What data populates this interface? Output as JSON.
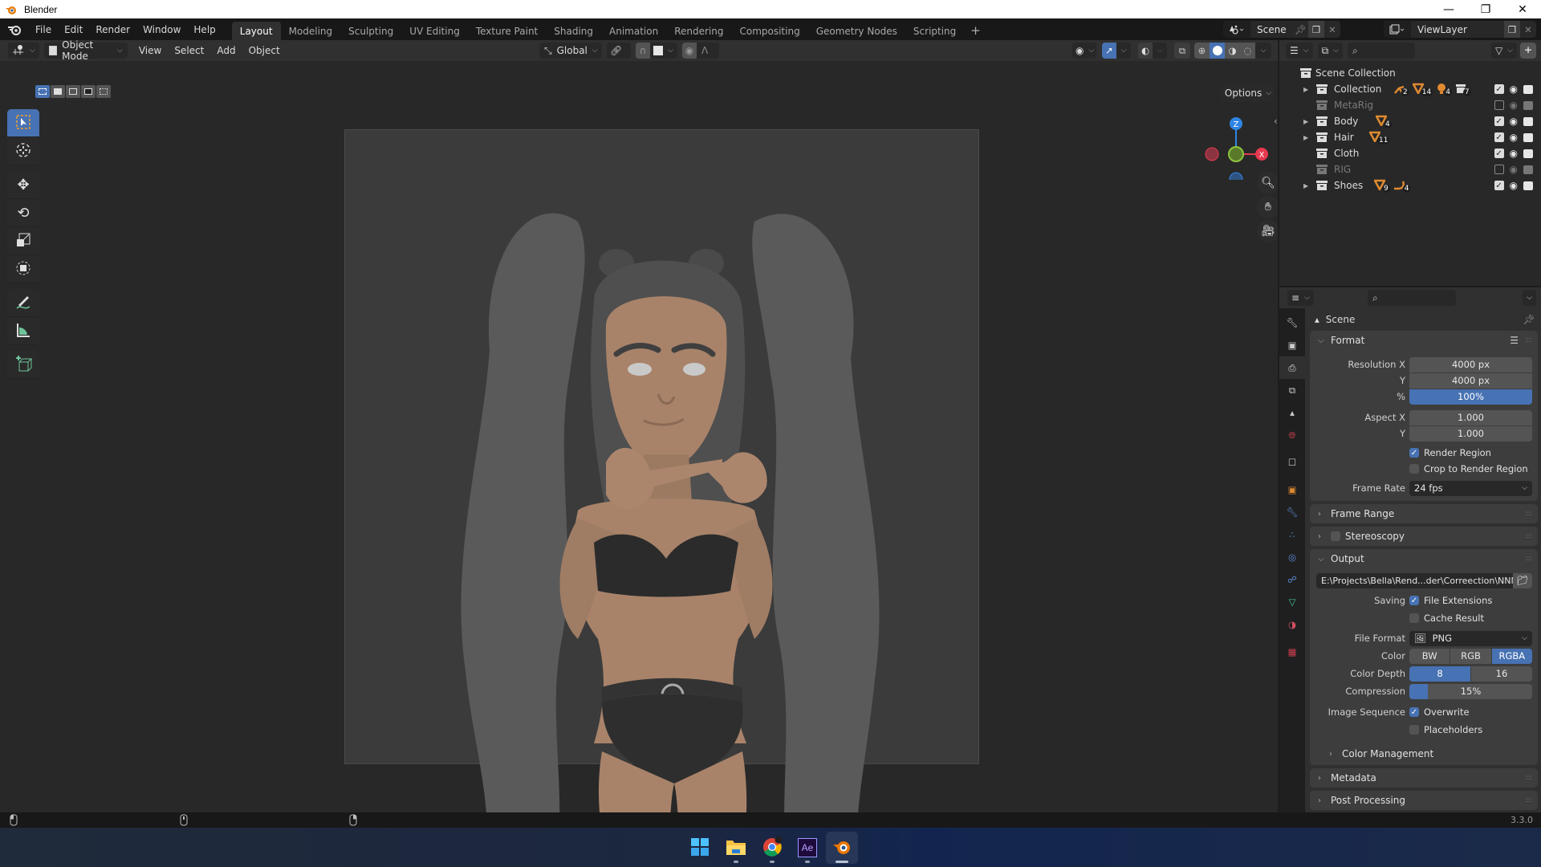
{
  "window": {
    "title": "Blender",
    "minimize": "—",
    "maximize": "❐",
    "close": "✕"
  },
  "topbar": {
    "menus": [
      "File",
      "Edit",
      "Render",
      "Window",
      "Help"
    ],
    "workspaces": [
      "Layout",
      "Modeling",
      "Sculpting",
      "UV Editing",
      "Texture Paint",
      "Shading",
      "Animation",
      "Rendering",
      "Compositing",
      "Geometry Nodes",
      "Scripting"
    ],
    "active_workspace": "Layout",
    "add_workspace": "+",
    "scene": "Scene",
    "view_layer": "ViewLayer"
  },
  "viewport": {
    "mode": "Object Mode",
    "menus": [
      "View",
      "Select",
      "Add",
      "Object"
    ],
    "transform_orientation": "Global",
    "options_label": "Options",
    "gizmo_axes": {
      "x": "X",
      "y": "Y",
      "z": "Z"
    },
    "axis_colors": {
      "x": "#e5394f",
      "y": "#8cc63f",
      "z": "#2f84e3"
    },
    "tools": [
      "select-box",
      "cursor",
      "move",
      "rotate",
      "scale",
      "transform",
      "annotate",
      "measure",
      "add-cube"
    ],
    "active_tool": "select-box",
    "shading_mode": "solid"
  },
  "outliner": {
    "root": "Scene Collection",
    "rows": [
      {
        "name": "Collection",
        "expandable": true,
        "enabled": true,
        "badges": [
          {
            "icon": "armature",
            "count": "2"
          },
          {
            "icon": "mesh",
            "count": "14"
          },
          {
            "icon": "light",
            "count": "4"
          },
          {
            "icon": "collection",
            "count": "7"
          }
        ]
      },
      {
        "name": "MetaRig",
        "expandable": false,
        "enabled": false,
        "badges": []
      },
      {
        "name": "Body",
        "expandable": true,
        "enabled": true,
        "badges": [
          {
            "icon": "mesh",
            "count": "4"
          }
        ]
      },
      {
        "name": "Hair",
        "expandable": true,
        "enabled": true,
        "badges": [
          {
            "icon": "mesh",
            "count": "11"
          }
        ]
      },
      {
        "name": "Cloth",
        "expandable": false,
        "enabled": true,
        "badges": []
      },
      {
        "name": "RIG",
        "expandable": false,
        "enabled": false,
        "badges": []
      },
      {
        "name": "Shoes",
        "expandable": true,
        "enabled": true,
        "badges": [
          {
            "icon": "mesh",
            "count": "9"
          },
          {
            "icon": "curve",
            "count": "4"
          }
        ]
      }
    ]
  },
  "properties": {
    "context": "Scene",
    "format": {
      "title": "Format",
      "resolution_x_label": "Resolution X",
      "resolution_x": "4000 px",
      "y_label": "Y",
      "resolution_y": "4000 px",
      "pct_label": "%",
      "resolution_pct": "100%",
      "aspect_x_label": "Aspect X",
      "aspect_x": "1.000",
      "aspect_y": "1.000",
      "render_region": "Render Region",
      "render_region_on": true,
      "crop_region": "Crop to Render Region",
      "crop_region_on": false,
      "frame_rate_label": "Frame Rate",
      "frame_rate": "24 fps"
    },
    "frame_range": "Frame Range",
    "stereoscopy": "Stereoscopy",
    "output": {
      "title": "Output",
      "path": "E:\\Projects\\Bella\\Rend...der\\Correection\\NNNN_",
      "saving_label": "Saving",
      "file_extensions": "File Extensions",
      "cache_result": "Cache Result",
      "file_format_label": "File Format",
      "file_format": "PNG",
      "color_label": "Color",
      "color_options": [
        "BW",
        "RGB",
        "RGBA"
      ],
      "color_selected": "RGBA",
      "color_depth_label": "Color Depth",
      "color_depth_options": [
        "8",
        "16"
      ],
      "color_depth_selected": "8",
      "compression_label": "Compression",
      "compression": "15%",
      "compression_value": 0.15,
      "image_sequence_label": "Image Sequence",
      "overwrite": "Overwrite",
      "placeholders": "Placeholders",
      "color_management": "Color Management"
    },
    "metadata": "Metadata",
    "post_processing": "Post Processing"
  },
  "statusbar": {
    "version": "3.3.0"
  },
  "taskbar": {
    "apps": [
      "start",
      "file-explorer",
      "chrome",
      "after-effects",
      "blender"
    ],
    "active": "blender",
    "ae_label": "Ae"
  }
}
